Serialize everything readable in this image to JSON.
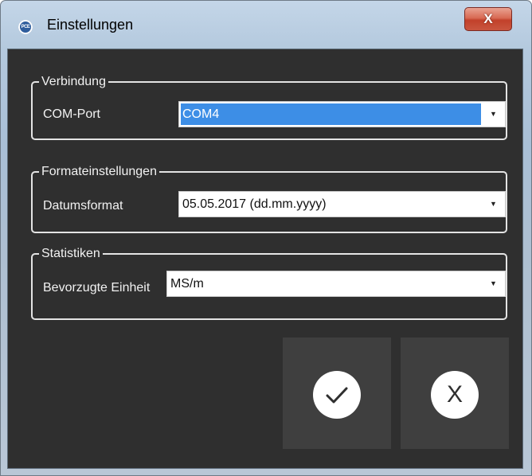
{
  "window": {
    "title": "Einstellungen",
    "icon": "pce-logo-icon",
    "icon_text": "PCE",
    "close_label": "X"
  },
  "groups": {
    "connection": {
      "legend": "Verbindung",
      "label": "COM-Port",
      "value": "COM4"
    },
    "format": {
      "legend": "Formateinstellungen",
      "label": "Datumsformat",
      "value": "05.05.2017 (dd.mm.yyyy)"
    },
    "statistics": {
      "legend": "Statistiken",
      "label": "Bevorzugte Einheit",
      "value": "MS/m"
    }
  },
  "actions": {
    "ok_icon": "checkmark-icon",
    "cancel_label": "X",
    "cancel_icon": "x-icon"
  },
  "colors": {
    "client_background": "#2f2f2f",
    "button_background": "#3f3f3f",
    "selection": "#3d8ee6",
    "close_button": "#c2412a"
  }
}
